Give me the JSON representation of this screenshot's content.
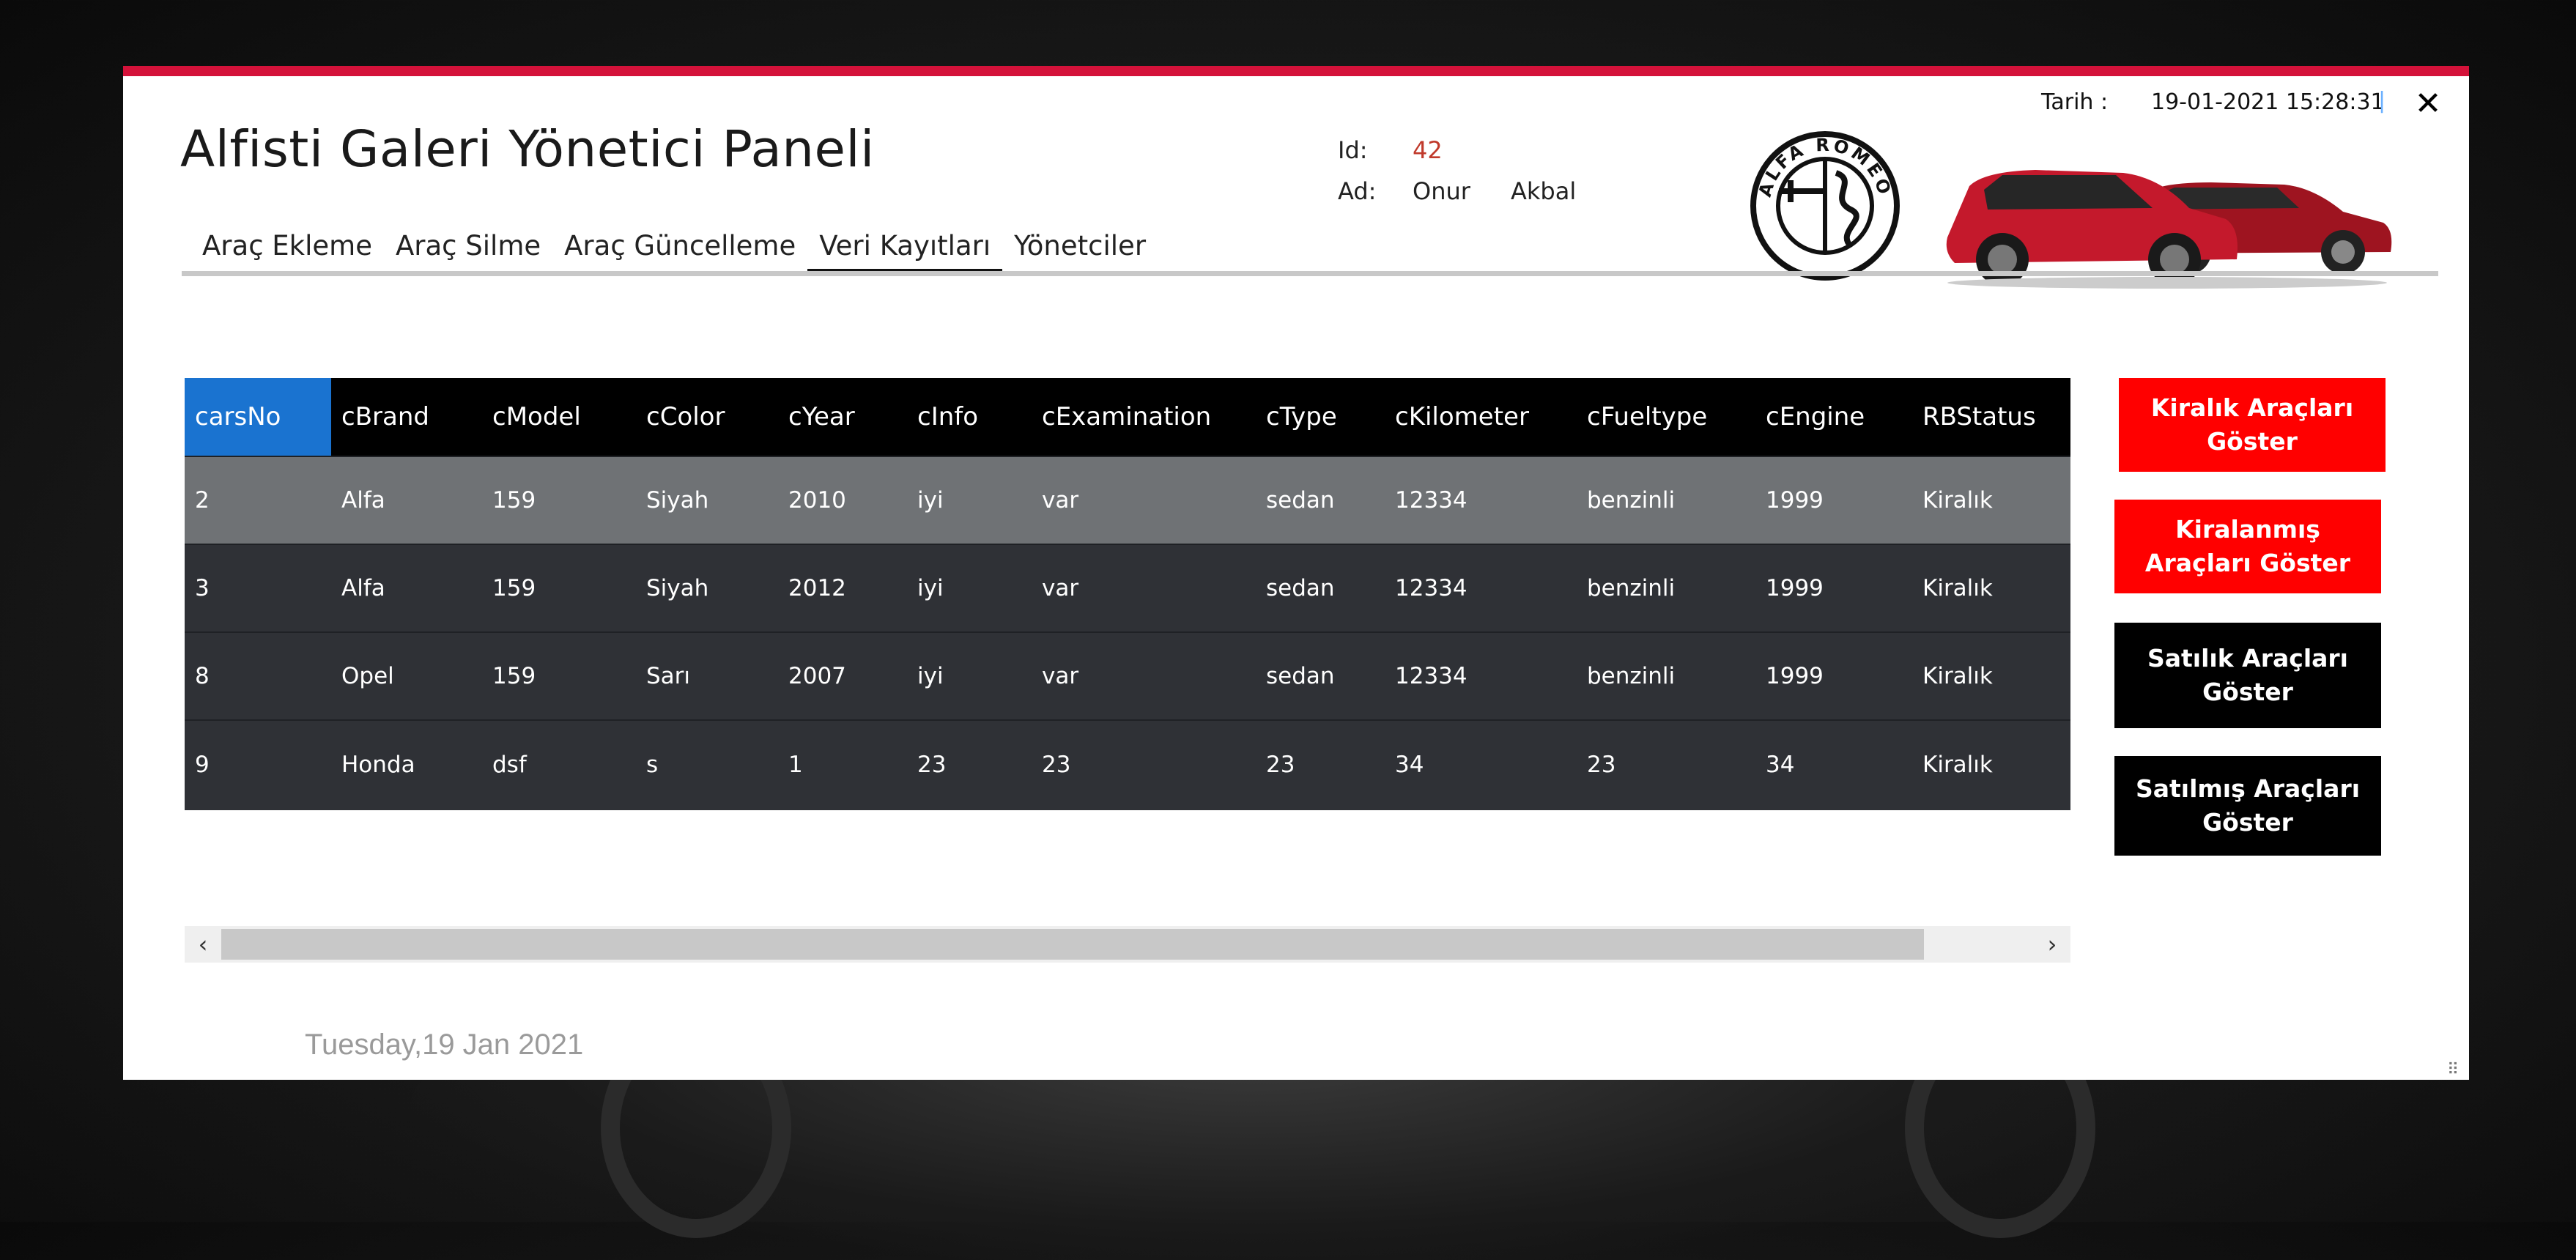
{
  "window": {
    "title": "Alfisti Galeri Yönetici Paneli",
    "close_label": "✕",
    "accent_color": "#d4123a"
  },
  "header": {
    "date_label": "Tarih :",
    "date_value": "19-01-2021 15:28:31",
    "date_sep": "|",
    "id_label": "Id:",
    "id_value": "42",
    "ad_label": "Ad:",
    "first_name": "Onur",
    "last_name": "Akbal",
    "logo_text": "ALFA ROMEO"
  },
  "nav": {
    "tabs": [
      {
        "label": "Araç Ekleme",
        "active": false
      },
      {
        "label": "Araç Silme",
        "active": false
      },
      {
        "label": "Araç Güncelleme",
        "active": false
      },
      {
        "label": "Veri Kayıtları",
        "active": true
      },
      {
        "label": "Yönetciler",
        "active": false
      }
    ]
  },
  "table": {
    "columns": [
      "carsNo",
      "cBrand",
      "cModel",
      "cColor",
      "cYear",
      "cInfo",
      "cExamination",
      "cType",
      "cKilometer",
      "cFueltype",
      "cEngine",
      "RBStatus"
    ],
    "rows": [
      [
        "2",
        "Alfa",
        "159",
        "Siyah",
        "2010",
        "iyi",
        "var",
        "sedan",
        "12334",
        "benzinli",
        "1999",
        "Kiralık"
      ],
      [
        "3",
        "Alfa",
        "159",
        "Siyah",
        "2012",
        "iyi",
        "var",
        "sedan",
        "12334",
        "benzinli",
        "1999",
        "Kiralık"
      ],
      [
        "8",
        "Opel",
        "159",
        "Sarı",
        "2007",
        "iyi",
        "var",
        "sedan",
        "12334",
        "benzinli",
        "1999",
        "Kiralık"
      ],
      [
        "9",
        "Honda",
        "dsf",
        "s",
        "1",
        "23",
        "23",
        "23",
        "34",
        "23",
        "34",
        "Kiralık"
      ]
    ],
    "selected_row": 0
  },
  "scroll": {
    "left": "‹",
    "right": "›"
  },
  "buttons": {
    "kiralik": "Kiralık Araçları Göster",
    "kiralanmis": "Kiralanmış Araçları Göster",
    "satilik": "Satılık Araçları Göster",
    "satilmis": "Satılmış Araçları Göster"
  },
  "footer": {
    "date": "Tuesday,19 Jan 2021"
  }
}
